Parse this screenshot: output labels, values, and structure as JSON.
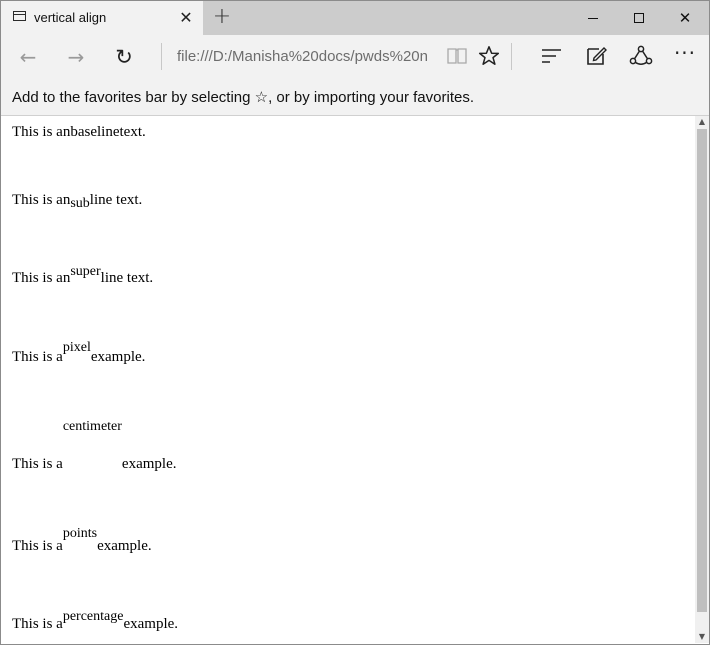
{
  "window": {
    "tab_title": "vertical align",
    "tab_close": "✕",
    "new_tab": "+",
    "close_glyph": "✕"
  },
  "nav": {
    "back": "←",
    "forward": "→",
    "refresh": "↻",
    "address": "file:///D:/Manisha%20docs/pwds%20n",
    "more": "···"
  },
  "favbar": {
    "message": "Add to the favorites bar by selecting ☆, or by importing your favorites."
  },
  "lines": [
    {
      "before": "This is an ",
      "special": "baseline",
      "after": " text."
    },
    {
      "before": "This is an ",
      "special": "sub",
      "after": " line text."
    },
    {
      "before": "This is an ",
      "special": "super",
      "after": " line text."
    },
    {
      "before": "This is a ",
      "special": "pixel",
      "after": " example."
    },
    {
      "before": "This is a ",
      "special": "centimeter",
      "after": " example."
    },
    {
      "before": "This is a ",
      "special": "points",
      "after": " example."
    },
    {
      "before": "This is a ",
      "special": "percentage",
      "after": " example."
    }
  ]
}
